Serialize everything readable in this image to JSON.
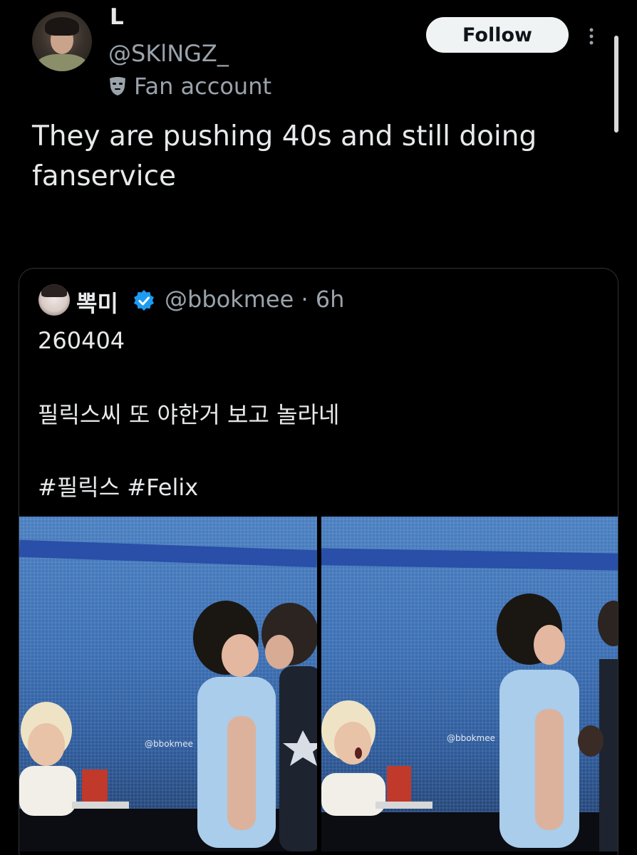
{
  "tweet": {
    "display_name": "L",
    "handle": "@SKlNGZ_",
    "account_label": "Fan account",
    "text": "They are pushing 40s and still doing fanservice",
    "follow_label": "Follow"
  },
  "quoted": {
    "name": "뽁미",
    "handle_time": "@bbokmee · 6h",
    "date": "260404",
    "line": "필릭스씨 또 야한거 보고 놀라네",
    "hashtags": "#필릭스 #Felix",
    "watermark": "@bbokmee"
  },
  "colors": {
    "background": "#000000",
    "text": "#e7e9ea",
    "secondary": "#9aa3ab",
    "verified": "#1d9bf0",
    "follow_bg": "#eff3f4"
  },
  "icons": {
    "mask": "theater-mask-icon",
    "verified": "verified-badge-icon",
    "more": "more-vertical-icon"
  }
}
